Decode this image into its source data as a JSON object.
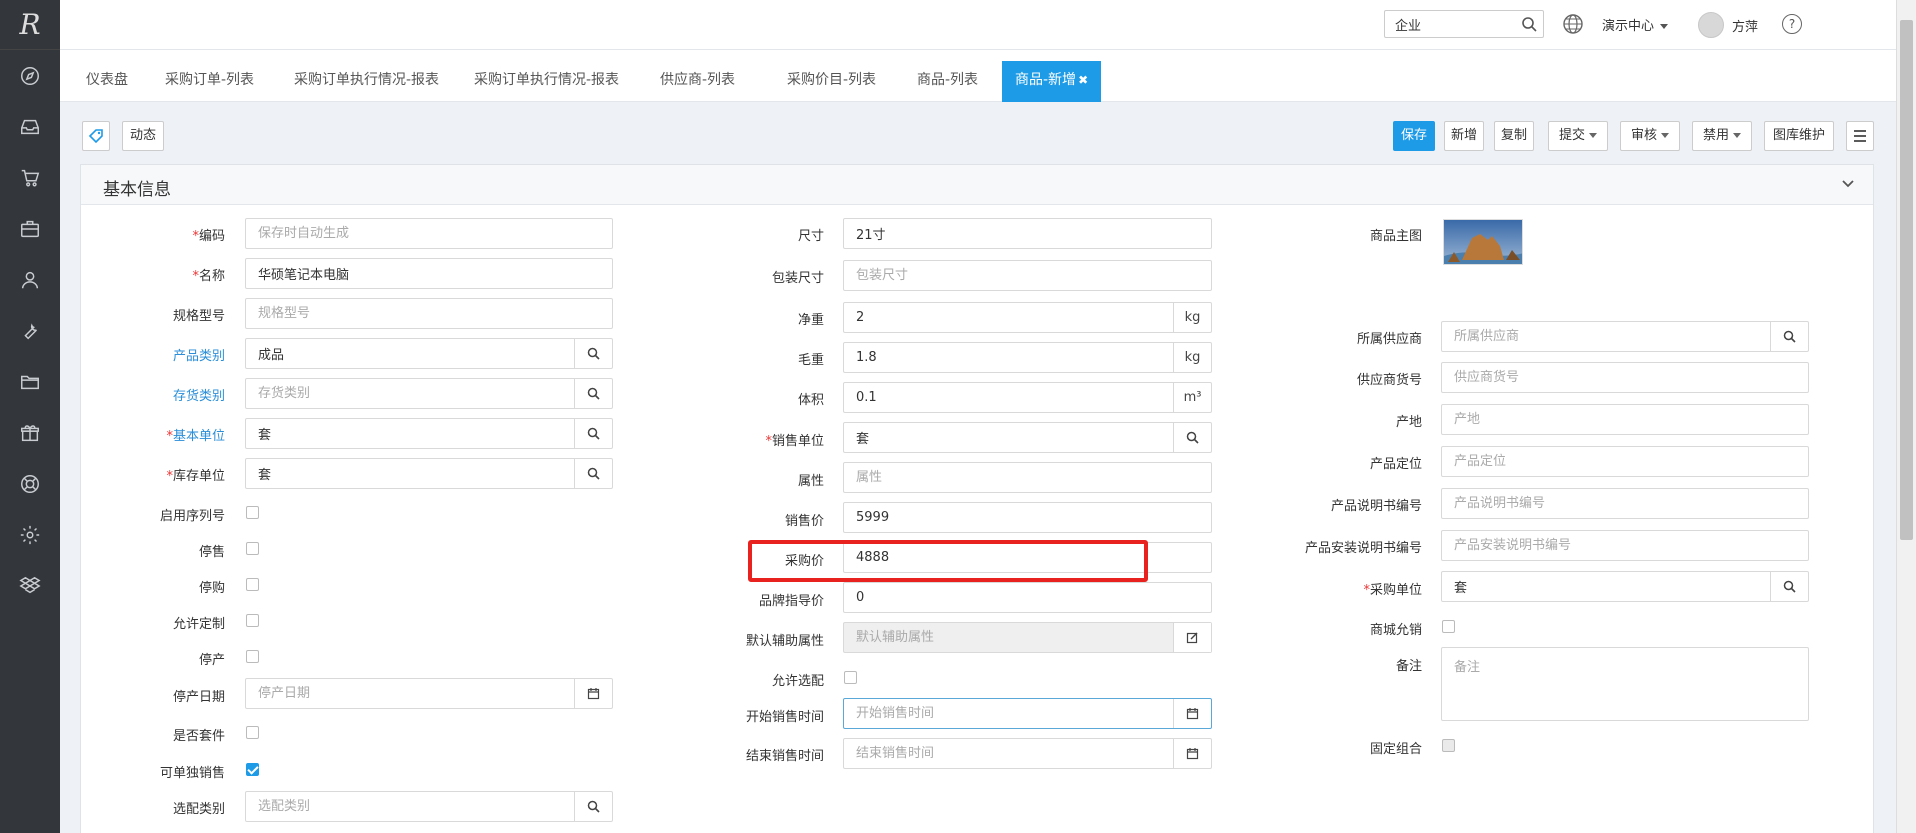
{
  "app": {
    "logo": "R"
  },
  "sidebar": {
    "icons": [
      "compass-icon",
      "inbox-icon",
      "cart-icon",
      "briefcase-icon",
      "user-icon",
      "wrench-icon",
      "folder-icon",
      "gift-icon",
      "lifebuoy-icon",
      "gear-icon",
      "dropbox-icon"
    ]
  },
  "header": {
    "search_value": "企业",
    "demo_center": "演示中心",
    "username": "方萍",
    "help": "?"
  },
  "tabs": [
    {
      "label": "仪表盘"
    },
    {
      "label": "采购订单-列表"
    },
    {
      "label": "采购订单执行情况-报表"
    },
    {
      "label": "采购订单执行情况-报表"
    },
    {
      "label": "供应商-列表"
    },
    {
      "label": "采购价目-列表"
    },
    {
      "label": "商品-列表"
    },
    {
      "label": "商品-新增"
    }
  ],
  "toolbar": {
    "dynamic": "动态",
    "save": "保存",
    "new": "新增",
    "copy": "复制",
    "submit": "提交",
    "audit": "审核",
    "disable": "禁用",
    "gallery": "图库维护"
  },
  "section": {
    "title": "基本信息"
  },
  "form": {
    "col1": {
      "code": {
        "label": "编码",
        "placeholder": "保存时自动生成",
        "value": ""
      },
      "name": {
        "label": "名称",
        "value": "华硕笔记本电脑"
      },
      "spec": {
        "label": "规格型号",
        "placeholder": "规格型号"
      },
      "product_category": {
        "label": "产品类别",
        "value": "成品"
      },
      "stock_category": {
        "label": "存货类别",
        "placeholder": "存货类别"
      },
      "base_unit": {
        "label": "基本单位",
        "value": "套"
      },
      "stock_unit": {
        "label": "库存单位",
        "value": "套"
      },
      "serial_enabled": {
        "label": "启用序列号",
        "checked": false
      },
      "stop_sale": {
        "label": "停售",
        "checked": false
      },
      "stop_purchase": {
        "label": "停购",
        "checked": false
      },
      "allow_custom": {
        "label": "允许定制",
        "checked": false
      },
      "stop_production": {
        "label": "停产",
        "checked": false
      },
      "stop_date": {
        "label": "停产日期",
        "placeholder": "停产日期"
      },
      "is_kit": {
        "label": "是否套件",
        "checked": false
      },
      "sell_alone": {
        "label": "可单独销售",
        "checked": true
      },
      "option_category": {
        "label": "选配类别",
        "placeholder": "选配类别"
      }
    },
    "col2": {
      "size": {
        "label": "尺寸",
        "value": "21寸"
      },
      "pack_size": {
        "label": "包装尺寸",
        "placeholder": "包装尺寸"
      },
      "net_weight": {
        "label": "净重",
        "value": "2",
        "unit": "kg"
      },
      "gross_weight": {
        "label": "毛重",
        "value": "1.8",
        "unit": "kg"
      },
      "volume": {
        "label": "体积",
        "value": "0.1",
        "unit": "m³"
      },
      "sale_unit": {
        "label": "销售单位",
        "value": "套"
      },
      "attribute": {
        "label": "属性",
        "placeholder": "属性"
      },
      "sale_price": {
        "label": "销售价",
        "value": "5999"
      },
      "purchase_price": {
        "label": "采购价",
        "value": "4888"
      },
      "brand_price": {
        "label": "品牌指导价",
        "value": "0"
      },
      "default_aux": {
        "label": "默认辅助属性",
        "placeholder": "默认辅助属性"
      },
      "allow_option": {
        "label": "允许选配",
        "checked": false
      },
      "sale_start": {
        "label": "开始销售时间",
        "placeholder": "开始销售时间"
      },
      "sale_end": {
        "label": "结束销售时间",
        "placeholder": "结束销售时间"
      }
    },
    "col3": {
      "main_image": {
        "label": "商品主图"
      },
      "supplier": {
        "label": "所属供应商",
        "placeholder": "所属供应商"
      },
      "supplier_code": {
        "label": "供应商货号",
        "placeholder": "供应商货号"
      },
      "origin": {
        "label": "产地",
        "placeholder": "产地"
      },
      "positioning": {
        "label": "产品定位",
        "placeholder": "产品定位"
      },
      "manual_no": {
        "label": "产品说明书编号",
        "placeholder": "产品说明书编号"
      },
      "install_manual_no": {
        "label": "产品安装说明书编号",
        "placeholder": "产品安装说明书编号"
      },
      "purchase_unit": {
        "label": "采购单位",
        "value": "套"
      },
      "mall_allow": {
        "label": "商城允销",
        "checked": false
      },
      "remark": {
        "label": "备注",
        "placeholder": "备注"
      },
      "fixed_combo": {
        "label": "固定组合",
        "checked": false
      }
    }
  },
  "colors": {
    "accent": "#1e9be7",
    "highlight": "#e8231f",
    "link": "#2a8ed8",
    "sidebar": "#33363b"
  }
}
